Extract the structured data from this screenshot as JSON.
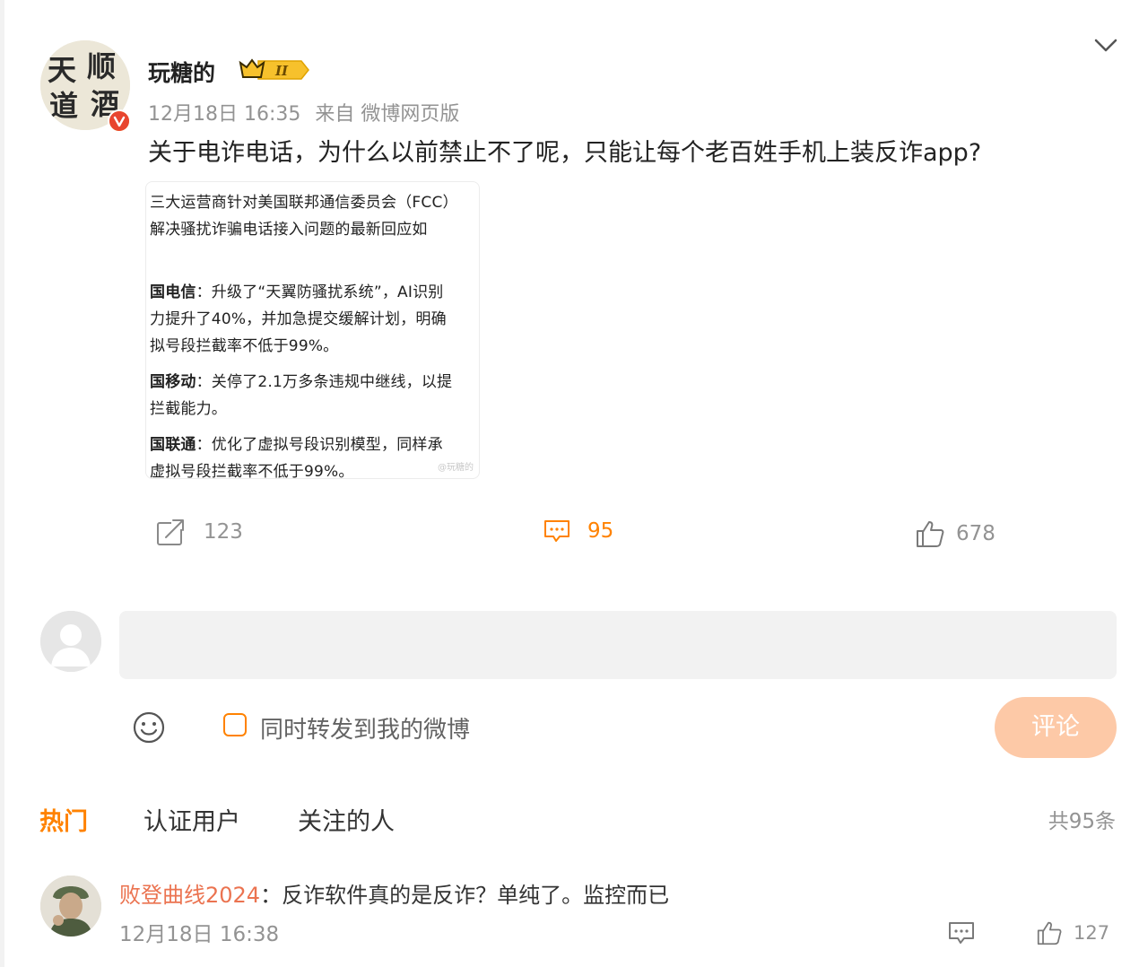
{
  "post": {
    "username": "玩糖的",
    "level_badge": "II",
    "date": "12月18日 16:35",
    "source": "来自 微博网页版",
    "text": "关于电诈电话，为什么以前禁止不了呢，只能让每个老百姓手机上装反诈app?",
    "avatar_chars": [
      "天",
      "顺",
      "道",
      "酒"
    ],
    "image_lines": [
      "三大运营商针对美国联邦通信委员会（FCC）",
      "解决骚扰诈骗电话接入问题的最新回应如",
      "国电信：升级了“天翼防骚扰系统”，AI识别",
      "力提升了40%，并加急提交缓解计划，明确",
      "拟号段拦截率不低于99%。",
      "国移动：关停了2.1万多条违规中继线，以提",
      "拦截能力。",
      "国联通：优化了虚拟号段识别模型，同样承",
      "虚拟号段拦截率不低于99%。"
    ],
    "image_bold": [
      "国电信",
      "国移动",
      "国联通"
    ],
    "image_watermark": "@玩糖的"
  },
  "actions": {
    "repost_count": "123",
    "comment_count": "95",
    "like_count": "678"
  },
  "composer": {
    "input_value": "",
    "forward_label": "同时转发到我的微博",
    "submit_label": "评论"
  },
  "tabs": [
    "热门",
    "认证用户",
    "关注的人"
  ],
  "total_count": "共95条",
  "comments": [
    {
      "user": "败登曲线2024",
      "separator": "：",
      "text": "反诈软件真的是反诈？单纯了。监控而已",
      "time": "12月18日 16:38",
      "like_count": "127"
    }
  ],
  "colors": {
    "accent": "#ff8200",
    "username_link": "#eb7350",
    "muted": "#939393",
    "submit_disabled": "#fdc9a7"
  },
  "icons": [
    "collapse-chevron-icon",
    "repost-icon",
    "comment-icon",
    "like-icon",
    "emoji-icon",
    "verified-v-icon"
  ]
}
